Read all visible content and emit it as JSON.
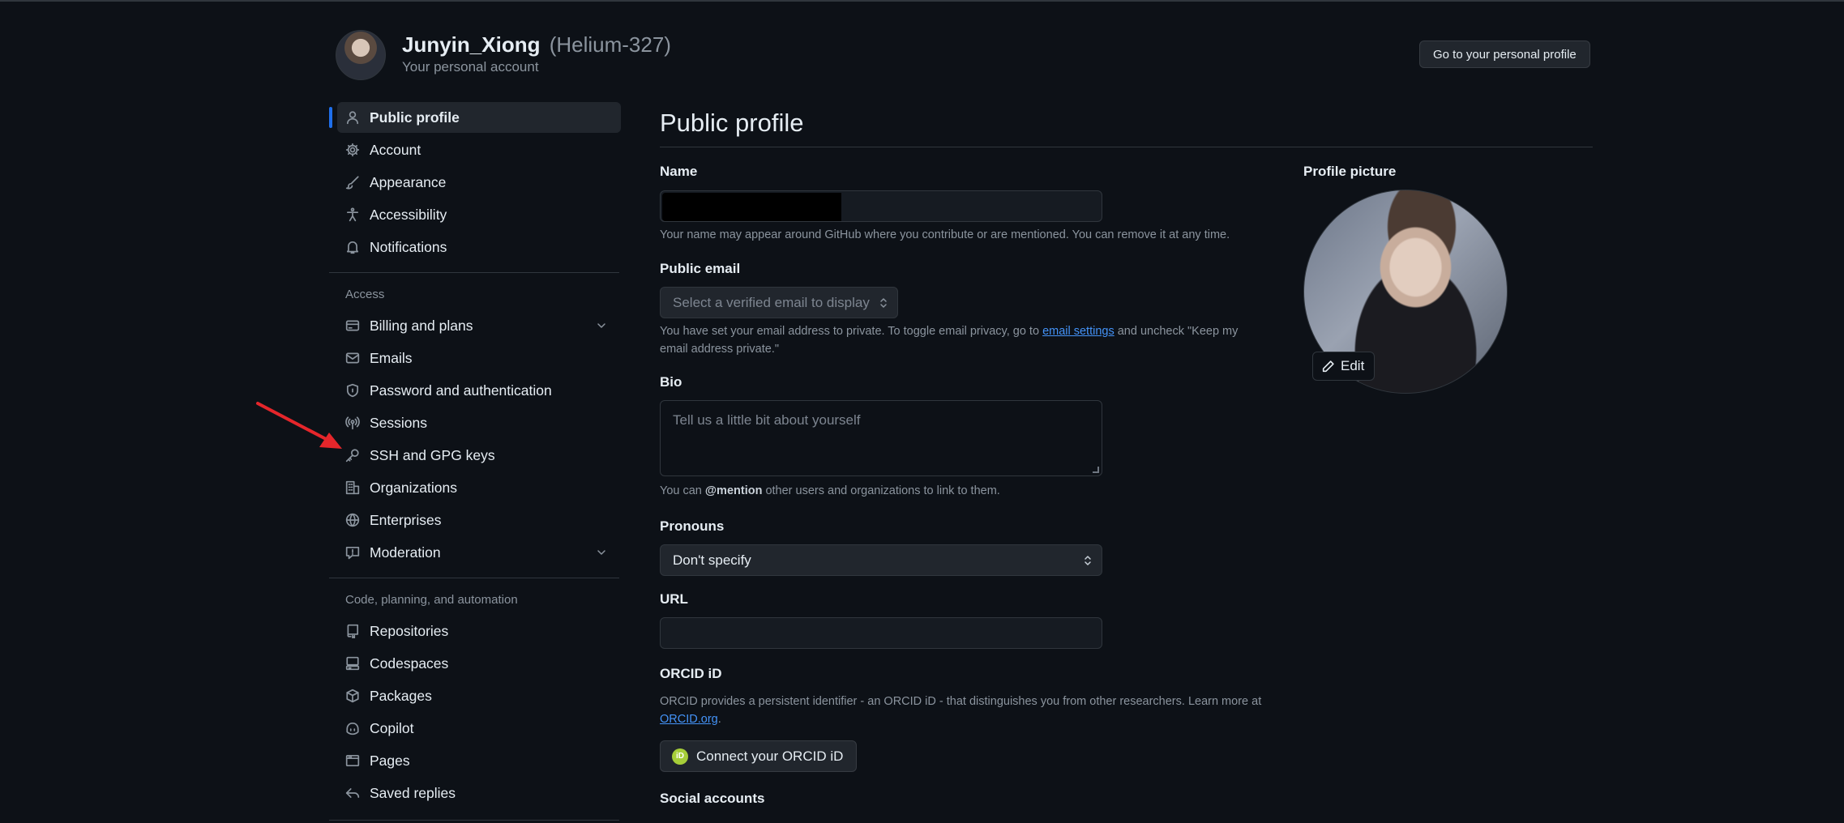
{
  "header": {
    "account_name": "Junyin_Xiong",
    "account_handle": "(Helium-327)",
    "account_subtitle": "Your personal account",
    "go_to_profile": "Go to your personal profile"
  },
  "sidebar": {
    "items_top": [
      {
        "label": "Public profile",
        "icon": "person-icon",
        "active": true
      },
      {
        "label": "Account",
        "icon": "gear-icon"
      },
      {
        "label": "Appearance",
        "icon": "paintbrush-icon"
      },
      {
        "label": "Accessibility",
        "icon": "accessibility-icon"
      },
      {
        "label": "Notifications",
        "icon": "bell-icon"
      }
    ],
    "group_access": "Access",
    "items_access": [
      {
        "label": "Billing and plans",
        "icon": "credit-card-icon",
        "expandable": true
      },
      {
        "label": "Emails",
        "icon": "mail-icon"
      },
      {
        "label": "Password and authentication",
        "icon": "shield-lock-icon"
      },
      {
        "label": "Sessions",
        "icon": "broadcast-icon"
      },
      {
        "label": "SSH and GPG keys",
        "icon": "key-icon"
      },
      {
        "label": "Organizations",
        "icon": "organization-icon"
      },
      {
        "label": "Enterprises",
        "icon": "globe-icon"
      },
      {
        "label": "Moderation",
        "icon": "report-icon",
        "expandable": true
      }
    ],
    "group_code": "Code, planning, and automation",
    "items_code": [
      {
        "label": "Repositories",
        "icon": "repo-icon"
      },
      {
        "label": "Codespaces",
        "icon": "codespaces-icon"
      },
      {
        "label": "Packages",
        "icon": "package-icon"
      },
      {
        "label": "Copilot",
        "icon": "copilot-icon"
      },
      {
        "label": "Pages",
        "icon": "browser-icon"
      },
      {
        "label": "Saved replies",
        "icon": "reply-icon"
      }
    ]
  },
  "main": {
    "title": "Public profile",
    "name_label": "Name",
    "name_help": "Your name may appear around GitHub where you contribute or are mentioned. You can remove it at any time.",
    "email_label": "Public email",
    "email_select": "Select a verified email to display",
    "email_help_1": "You have set your email address to private. To toggle email privacy, go to ",
    "email_help_link": "email settings",
    "email_help_2": " and uncheck \"Keep my",
    "email_help_3": "email address private.\"",
    "bio_label": "Bio",
    "bio_placeholder": "Tell us a little bit about yourself",
    "bio_help_1": "You can ",
    "bio_help_mention": "@mention",
    "bio_help_2": " other users and organizations to link to them.",
    "pronouns_label": "Pronouns",
    "pronouns_value": "Don't specify",
    "url_label": "URL",
    "orcid_label": "ORCID iD",
    "orcid_help_1": "ORCID provides a persistent identifier - an ORCID iD - that distinguishes you from other researchers. Learn more at",
    "orcid_help_link": "ORCID.org",
    "orcid_help_dot": ".",
    "orcid_logo": "iD",
    "orcid_button": "Connect your ORCID iD",
    "social_label": "Social accounts"
  },
  "profile_picture": {
    "label": "Profile picture",
    "edit": "Edit"
  },
  "colors": {
    "background": "#0d1117",
    "accent": "#1f6feb",
    "link": "#4493f8",
    "annotation_arrow": "#e5262b"
  }
}
